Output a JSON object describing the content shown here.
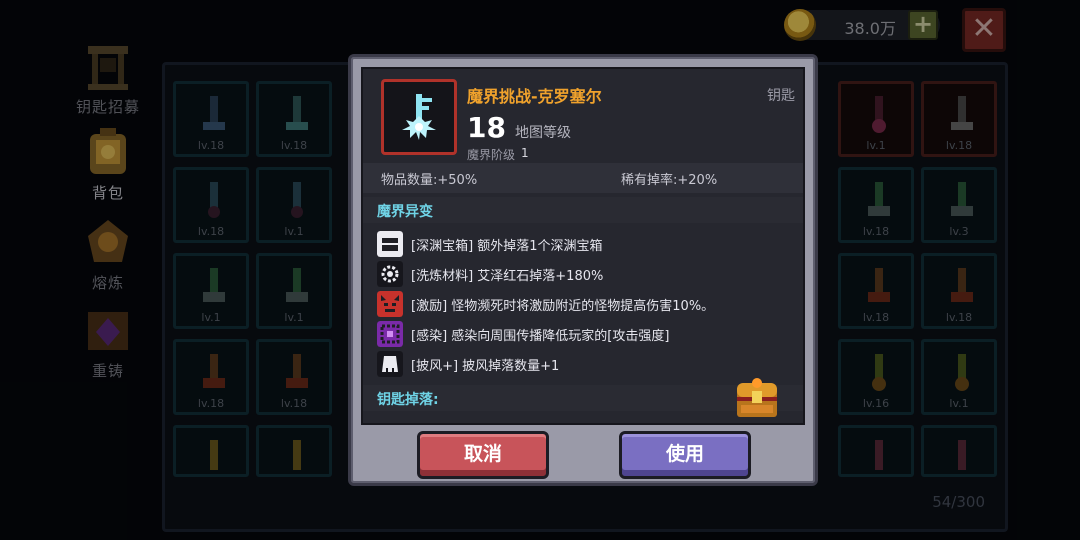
{
  "nav": {
    "items": [
      {
        "label": "钥匙招募",
        "icon": "shrine-icon"
      },
      {
        "label": "背包",
        "icon": "backpack-icon"
      },
      {
        "label": "熔炼",
        "icon": "forge-icon"
      },
      {
        "label": "重铸",
        "icon": "recast-icon"
      }
    ]
  },
  "currency": {
    "value": "38.0万",
    "add_label": "+"
  },
  "close_label": "✕",
  "inventory": {
    "count": "54/300",
    "slots": [
      {
        "lv": "lv.18"
      },
      {
        "lv": "lv.18"
      },
      {
        "lv": "lv.1"
      },
      {
        "lv": "lv.18"
      },
      {
        "lv": "lv.18"
      },
      {
        "lv": "lv.1"
      },
      {
        "lv": "lv.18"
      },
      {
        "lv": "lv.3"
      },
      {
        "lv": "lv.1"
      },
      {
        "lv": "lv.1"
      },
      {
        "lv": "lv.18"
      },
      {
        "lv": "lv.18"
      },
      {
        "lv": "lv.18"
      },
      {
        "lv": "lv.18"
      },
      {
        "lv": "lv.16"
      },
      {
        "lv": "lv.1"
      },
      {
        "lv": ""
      },
      {
        "lv": ""
      },
      {
        "lv": ""
      },
      {
        "lv": ""
      }
    ]
  },
  "modal": {
    "name": "魔界挑战-克罗塞尔",
    "type": "钥匙",
    "level": "18",
    "level_label": "地图等级",
    "tier_label": "魔界阶级",
    "tier_value": "1",
    "stats": {
      "quantity": "物品数量:+50%",
      "rare_drop": "稀有掉率:+20%"
    },
    "anomaly_title": "魔界异变",
    "modifiers": [
      {
        "text": "[深渊宝箱] 额外掉落1个深渊宝箱",
        "icon": "chest-icon",
        "color": "#ececf2"
      },
      {
        "text": "[洗炼材料] 艾泽红石掉落+180%",
        "icon": "gear-icon",
        "color": "#ececf2"
      },
      {
        "text": "[激励] 怪物濒死时将激励附近的怪物提高伤害10%。",
        "icon": "demon-face-icon",
        "color": "#c8322c"
      },
      {
        "text": "[感染] 感染向周围传播降低玩家的[攻击强度]",
        "icon": "virus-icon",
        "color": "#7a2aa8"
      },
      {
        "text": "[披风+] 披风掉落数量+1",
        "icon": "cape-icon",
        "color": "#ececf2"
      }
    ],
    "drop_title": "钥匙掉落:",
    "cancel_label": "取消",
    "use_label": "使用"
  }
}
